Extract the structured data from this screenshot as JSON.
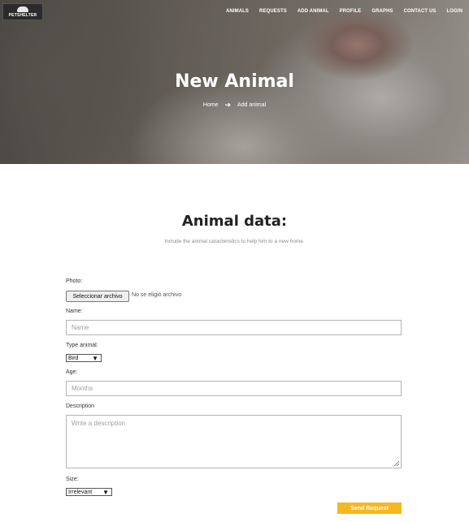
{
  "brand": {
    "logo_text": "PETSHELTER"
  },
  "nav": {
    "items": [
      {
        "label": "ANIMALS"
      },
      {
        "label": "REQUESTS"
      },
      {
        "label": "ADD ANIMAL"
      },
      {
        "label": "PROFILE"
      },
      {
        "label": "GRAPHS"
      },
      {
        "label": "CONTACT US"
      },
      {
        "label": "LOGIN"
      }
    ]
  },
  "hero": {
    "title": "New Animal",
    "breadcrumb": {
      "home": "Home",
      "current": "Add animal",
      "separator_icon": "arrow-right-icon"
    }
  },
  "section": {
    "title": "Animal data:",
    "subtitle": "Include the animal caracteristics to help him to a new home."
  },
  "form": {
    "photo": {
      "label": "Photo:",
      "button": "Seleccionar archivo",
      "status": "No se eligió archivo"
    },
    "name": {
      "label": "Name:",
      "placeholder": "Name",
      "value": ""
    },
    "type": {
      "label": "Type animal:",
      "selected": "Bird"
    },
    "age": {
      "label": "Age:",
      "placeholder": "Months",
      "value": ""
    },
    "description": {
      "label": "Description",
      "placeholder": "Write a description",
      "value": ""
    },
    "size": {
      "label": "Size:",
      "selected": "Irrelevant"
    },
    "submit": {
      "label": "Send Request"
    }
  },
  "colors": {
    "accent": "#f5b81e",
    "text": "#222222",
    "muted": "#8a8a8a"
  }
}
